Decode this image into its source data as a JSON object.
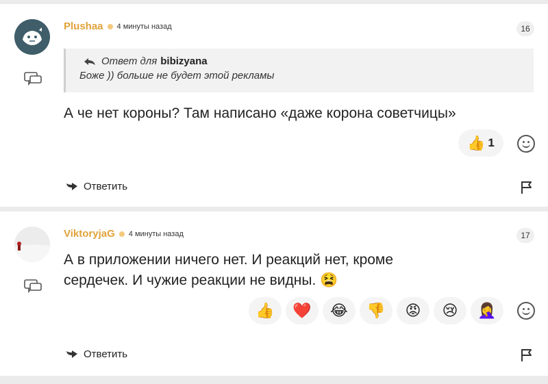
{
  "comments": [
    {
      "author": "Plushaa",
      "time": "4 минуты назад",
      "number": "16",
      "quote": {
        "prefix": "Ответ для",
        "to": "bibizyana",
        "text": "Боже )) больше не будет этой рекламы"
      },
      "text": "А че нет короны? Там написано «даже корона советчицы»",
      "reactions": [
        {
          "emoji": "👍",
          "count": "1"
        }
      ],
      "reply_label": "Ответить"
    },
    {
      "author": "ViktoryjaG",
      "time": "4 минуты назад",
      "number": "17",
      "text_line1": "А в приложении ничего нет. И реакций нет, кроме",
      "text_line2": "сердечек. И чужие реакции не видны.",
      "text_emoji": "😫",
      "reaction_options": [
        "👍",
        "❤️",
        "😂",
        "👎",
        "😡",
        "😢",
        "🤦‍♀️"
      ],
      "reply_label": "Ответить"
    }
  ],
  "colors": {
    "author": "#e0a23a",
    "background": "#ebebeb"
  },
  "icons": [
    "comment-bubble-icon",
    "reply-arrow-icon",
    "flag-icon",
    "add-reaction-icon"
  ]
}
